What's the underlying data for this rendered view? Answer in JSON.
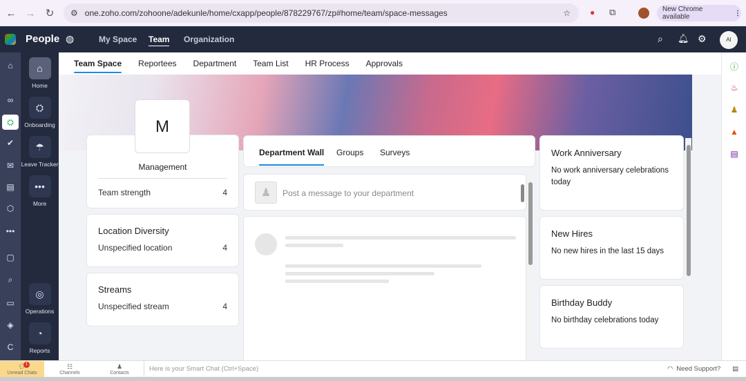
{
  "browser": {
    "url": "one.zoho.com/zohoone/adekunle/home/cxapp/people/878229767/zp#home/team/space-messages",
    "update_label": "New Chrome available"
  },
  "app": {
    "name": "People",
    "nav": [
      "My Space",
      "Team",
      "Organization"
    ],
    "avatar": "AI"
  },
  "sidebar": [
    {
      "label": "Home"
    },
    {
      "label": "Onboarding"
    },
    {
      "label": "Leave Tracker"
    },
    {
      "label": "More"
    },
    {
      "label": "Operations"
    },
    {
      "label": "Reports"
    }
  ],
  "tabs": [
    "Team Space",
    "Reportees",
    "Department",
    "Team List",
    "HR Process",
    "Approvals"
  ],
  "department": {
    "initial": "M",
    "name": "Management",
    "strength_label": "Team strength",
    "strength": "4"
  },
  "location": {
    "title": "Location Diversity",
    "label": "Unspecified location",
    "count": "4"
  },
  "streams": {
    "title": "Streams",
    "label": "Unspecified stream",
    "count": "4"
  },
  "wall": {
    "tabs": [
      "Department Wall",
      "Groups",
      "Surveys"
    ],
    "post_placeholder": "Post a message to your department"
  },
  "widgets": [
    {
      "title": "Work Anniversary",
      "text": "No work anniversary celebrations today"
    },
    {
      "title": "New Hires",
      "text": "No new hires in the last 15 days"
    },
    {
      "title": "Birthday Buddy",
      "text": "No birthday celebrations today"
    }
  ],
  "bottom": {
    "unread": "Unread Chats",
    "badge": "1",
    "channels": "Channels",
    "contacts": "Contacts",
    "smart_chat": "Here is your Smart Chat (Ctrl+Space)",
    "support": "Need Support?"
  }
}
